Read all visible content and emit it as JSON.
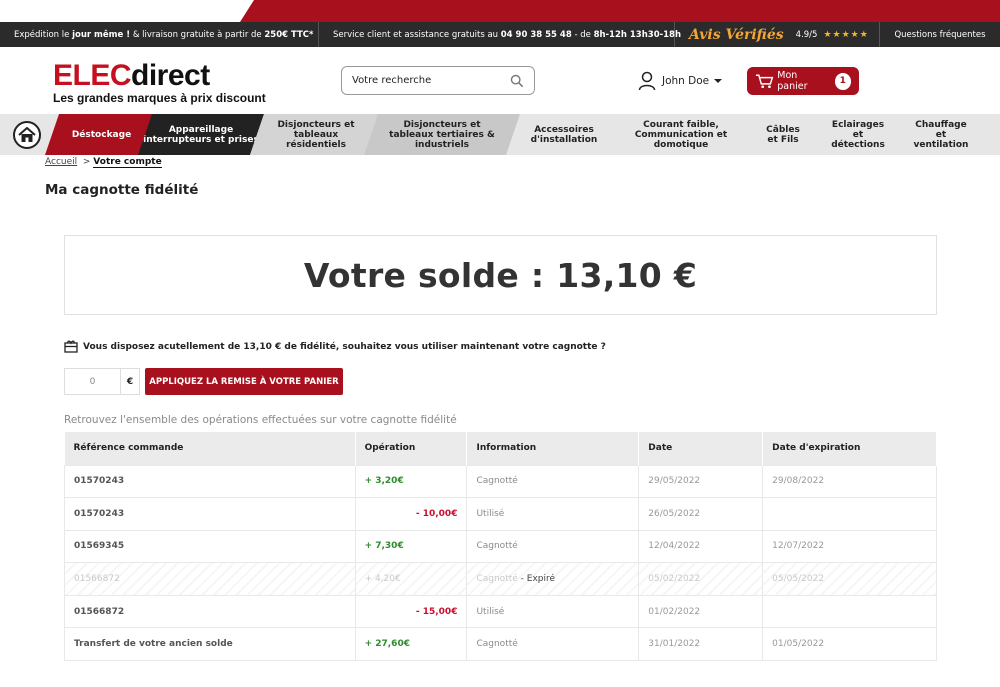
{
  "infobar": {
    "shipping_pre": "Expédition le",
    "shipping_bold": "jour même !",
    "shipping_mid": "& livraison gratuite à partir de",
    "shipping_amount": "250€ TTC*",
    "service_pre": "Service client et assistance gratuits au",
    "service_phone": "04 90 38 55 48",
    "service_mid": "- de",
    "service_hours": "8h-12h 13h30-18h",
    "reviews_brand": "Avis Vérifiés",
    "rating": "4.9/5",
    "stars": "★★★★★",
    "faq": "Questions fréquentes"
  },
  "header": {
    "logo_red": "ELEC",
    "logo_black": "direct",
    "tagline": "Les grandes marques à prix discount",
    "search_placeholder": "Votre recherche",
    "user_name": "John Doe",
    "cart_label": "Mon panier",
    "cart_count": "1"
  },
  "nav": {
    "items": [
      {
        "label": "Déstockage"
      },
      {
        "label": "Appareillage interrupteurs et prises"
      },
      {
        "label": "Disjoncteurs et tableaux résidentiels"
      },
      {
        "label": "Disjoncteurs et tableaux tertiaires & industriels"
      },
      {
        "label": "Accessoires d'installation"
      },
      {
        "label": "Courant faible, Communication et domotique"
      },
      {
        "label": "Câbles et Fils"
      },
      {
        "label": "Eclairages et détections"
      },
      {
        "label": "Chauffage et ventilation"
      }
    ]
  },
  "breadcrumb": {
    "home": "Accueil",
    "separator": ">",
    "current": "Votre compte"
  },
  "page": {
    "title": "Ma cagnotte fidélité",
    "balance": "Votre solde : 13,10 €",
    "notice": "Vous disposez acutellement de 13,10 € de fidélité, souhaitez vous utiliser maintenant votre cagnotte ?",
    "amount_value": "0",
    "currency": "€",
    "apply_button": "APPLIQUEZ LA REMISE À VOTRE PANIER",
    "ops_caption": "Retrouvez l'ensemble des opérations effectuées sur votre cagnotte fidélité"
  },
  "table": {
    "headers": [
      "Référence commande",
      "Opération",
      "Information",
      "Date",
      "Date d'expiration"
    ],
    "rows": [
      {
        "ref": "01570243",
        "op": "+ 3,20€",
        "info": "Cagnotté",
        "tag": "",
        "date": "29/05/2022",
        "exp": "29/08/2022"
      },
      {
        "ref": "01570243",
        "op": "- 10,00€",
        "info": "Utilisé",
        "tag": "",
        "date": "26/05/2022",
        "exp": ""
      },
      {
        "ref": "01569345",
        "op": "+ 7,30€",
        "info": "Cagnotté",
        "tag": "",
        "date": "12/04/2022",
        "exp": "12/07/2022"
      },
      {
        "ref": "01566872",
        "op": "+ 4,20€",
        "info": "Cagnotté",
        "tag": "- Expiré",
        "date": "05/02/2022",
        "exp": "05/05/2022"
      },
      {
        "ref": "01566872",
        "op": "- 15,00€",
        "info": "Utilisé",
        "tag": "",
        "date": "01/02/2022",
        "exp": ""
      },
      {
        "ref": "Transfert de votre ancien solde",
        "op": "+ 27,60€",
        "info": "Cagnotté",
        "tag": "",
        "date": "31/01/2022",
        "exp": "01/05/2022"
      }
    ]
  }
}
